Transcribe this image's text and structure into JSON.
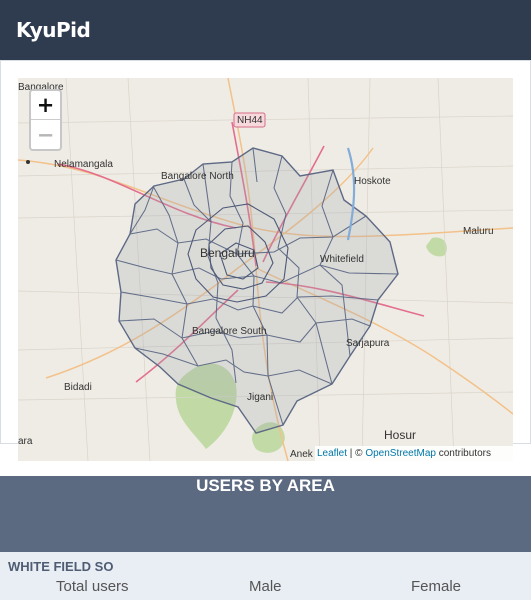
{
  "app": {
    "title": "KyuPid"
  },
  "map": {
    "zoom_in": "+",
    "zoom_out": "−",
    "labels": {
      "top_left": "Bangalore",
      "nelamangala": "Nelamangala",
      "hoskote": "Hoskote",
      "maluru": "Maluru",
      "bengaluru": "Bengaluru",
      "whitefield": "Whitefield",
      "sarjapura": "Sarjapura",
      "bidadi": "Bidadi",
      "jigani": "Jigani",
      "hosur": "Hosur",
      "ara": "ara",
      "nh44": "NH44",
      "north": "Bangalore North",
      "south": "Bangalore South",
      "anek": "Anek"
    },
    "attribution": {
      "leaflet": "Leaflet",
      "separator": " | © ",
      "osm": "OpenStreetMap",
      "suffix": " contributors"
    }
  },
  "users_by_area": {
    "title": "USERS BY AREA",
    "area": "WHITE FIELD SO",
    "columns": [
      "Total users",
      "Male",
      "Female"
    ]
  }
}
